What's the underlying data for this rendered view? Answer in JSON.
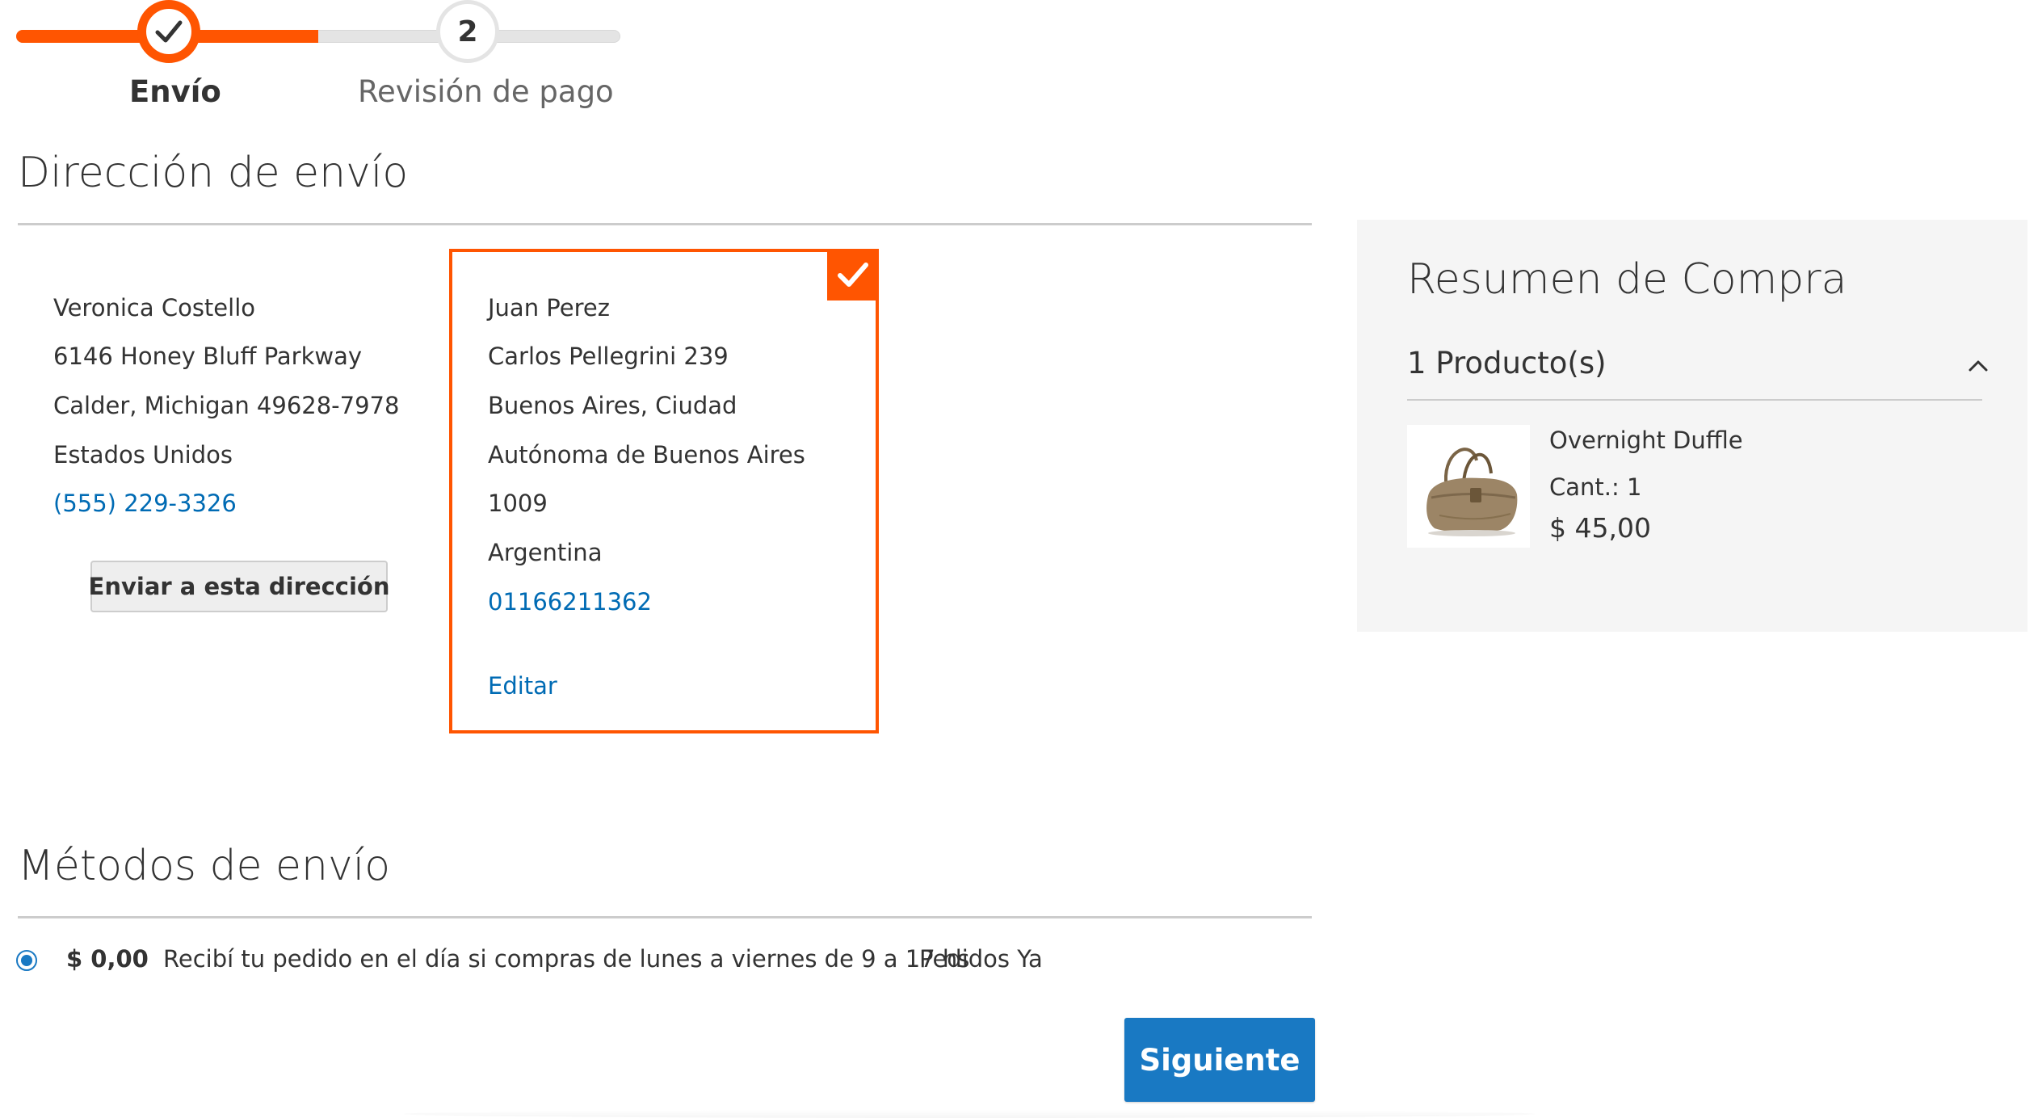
{
  "progress": {
    "steps": [
      {
        "number": "1",
        "label": "Envío",
        "state": "complete"
      },
      {
        "number": "2",
        "label": "Revisión de pago",
        "state": "pending"
      }
    ],
    "accent_color": "#ff5501",
    "completed_fraction": 0.5
  },
  "shipping_address": {
    "title": "Dirección de envío",
    "addresses": [
      {
        "lines": [
          "Veronica Costello",
          "6146 Honey Bluff Parkway",
          "Calder, Michigan 49628-7978",
          "Estados Unidos"
        ],
        "phone": "(555) 229-3326",
        "ship_here_label": "Enviar a esta dirección",
        "selected": false
      },
      {
        "lines": [
          "Juan Perez",
          "Carlos Pellegrini 239",
          "Buenos Aires, Ciudad",
          "Autónoma de Buenos Aires",
          "1009",
          "Argentina"
        ],
        "phone": "01166211362",
        "edit_label": "Editar",
        "selected": true
      }
    ]
  },
  "shipping_methods": {
    "title": "Métodos de envío",
    "methods": [
      {
        "price": "$ 0,00",
        "description": "Recibí tu pedido en el día si compras de lunes a viernes de 9 a 17 hs",
        "carrier": "Pedidos Ya",
        "selected": true
      }
    ],
    "next_label": "Siguiente",
    "button_color": "#1979c3"
  },
  "summary": {
    "title": "Resumen de Compra",
    "items_count_label": "1 Producto(s)",
    "items": [
      {
        "name": "Overnight Duffle",
        "qty_label": "Cant.: 1",
        "price": "$ 45,00",
        "image_icon": "duffle-bag-icon"
      }
    ]
  },
  "link_color": "#006bb4"
}
